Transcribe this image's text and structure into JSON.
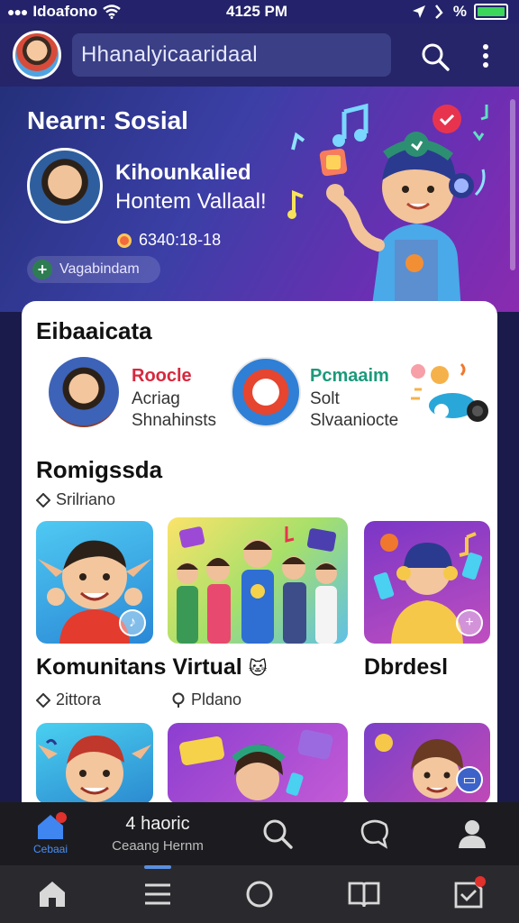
{
  "status_bar": {
    "carrier": "Idoafono",
    "time": "4125 PM",
    "battery_text": "%",
    "battery_level": 1.0,
    "battery_color": "#3bd65a"
  },
  "app_bar": {
    "search_text": "Hhanalyicaaridaal"
  },
  "hero": {
    "title": "Nearn: Sosial",
    "name": "Kihounkalied",
    "subtitle": "Hontem Vallaal!",
    "meta": "6340:18-18",
    "chip_label": "Vagabindam"
  },
  "featured": {
    "title": "Eibaaicata",
    "items": [
      {
        "name": "Roocle",
        "line1": "Acriag",
        "line2": "Shnahinsts",
        "name_color": "#d7283e"
      },
      {
        "name": "Pcmaaim",
        "line1": "Solt",
        "line2": "Slvaaniocte",
        "name_color": "#1b9a7a"
      }
    ]
  },
  "recommended": {
    "title": "Romigssda",
    "meta": "Srilriano"
  },
  "rows": {
    "label_1": "Komunitans Virtual",
    "emoji_1": "🐱",
    "label_2": "Dbrdesl",
    "meta_1": "2ittora",
    "meta_2": "Pldano"
  },
  "tab_bar": {
    "home_label": "Cebaai",
    "center_title": "4 haoric",
    "center_sub": "Ceaang Hernm"
  },
  "accent_color": "#4a8ff5",
  "notification_color": "#e0312d"
}
